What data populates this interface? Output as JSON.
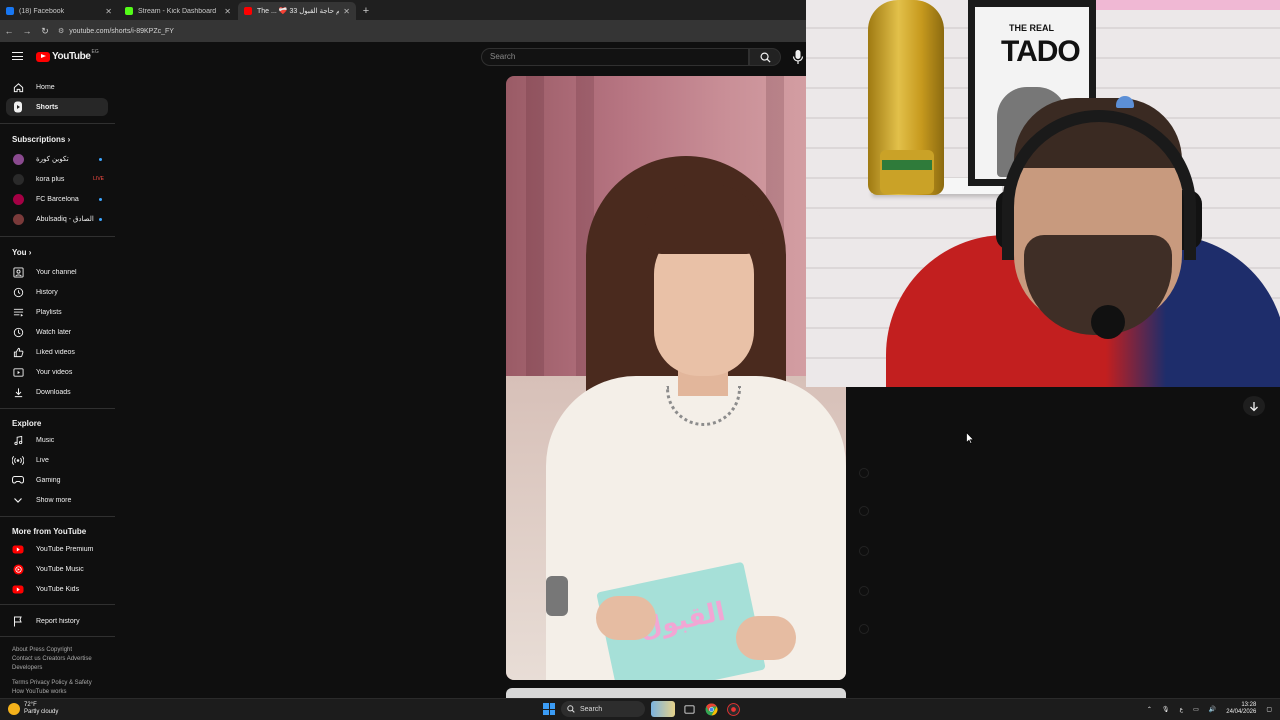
{
  "browser": {
    "tabs": [
      {
        "title": "(18) Facebook",
        "color": "#1877f2",
        "active": false
      },
      {
        "title": "Stream - Kick Dashboard",
        "color": "#53fc18",
        "active": false
      },
      {
        "title": "The ... ❤️‍🩹 33 اهم حاجة القبول",
        "color": "#ff0000",
        "active": true
      }
    ],
    "new_tab": "+",
    "url": "youtube.com/shorts/i-89KPZc_FY"
  },
  "masthead": {
    "logo_text": "YouTube",
    "country_code": "EG",
    "search_placeholder": "Search"
  },
  "sidebar": {
    "main": [
      {
        "label": "Home",
        "icon": "home-icon"
      },
      {
        "label": "Shorts",
        "icon": "shorts-icon",
        "active": true
      }
    ],
    "subscriptions_title": "Subscriptions",
    "subscriptions": [
      {
        "label": "تكوين كورة",
        "badge": "dot",
        "avatar_color": "#8a4a8f"
      },
      {
        "label": "kora plus",
        "badge": "live",
        "avatar_color": "#2a2a2a"
      },
      {
        "label": "FC Barcelona",
        "badge": "dot",
        "avatar_color": "#a50044"
      },
      {
        "label": "Abulsadiq - الصادق",
        "badge": "dot",
        "avatar_color": "#7a3a3a"
      }
    ],
    "live_badge": "LIVE",
    "you_title": "You",
    "you": [
      {
        "label": "Your channel",
        "icon": "channel-icon"
      },
      {
        "label": "History",
        "icon": "history-icon"
      },
      {
        "label": "Playlists",
        "icon": "playlists-icon"
      },
      {
        "label": "Watch later",
        "icon": "watch-later-icon"
      },
      {
        "label": "Liked videos",
        "icon": "like-icon"
      },
      {
        "label": "Your videos",
        "icon": "videos-icon"
      },
      {
        "label": "Downloads",
        "icon": "download-icon"
      }
    ],
    "explore_title": "Explore",
    "explore": [
      {
        "label": "Music",
        "icon": "music-icon"
      },
      {
        "label": "Live",
        "icon": "live-icon"
      },
      {
        "label": "Gaming",
        "icon": "gaming-icon"
      },
      {
        "label": "Show more",
        "icon": "chevron-down-icon"
      }
    ],
    "more_title": "More from YouTube",
    "more": [
      {
        "label": "YouTube Premium",
        "icon": "youtube-premium-icon"
      },
      {
        "label": "YouTube Music",
        "icon": "youtube-music-icon"
      },
      {
        "label": "YouTube Kids",
        "icon": "youtube-kids-icon"
      }
    ],
    "report_history": "Report history",
    "footer_line1": "About  Press  Copyright",
    "footer_line2": "Contact us  Creators  Advertise",
    "footer_line3": "Developers",
    "footer_line4": "Terms  Privacy  Policy & Safety",
    "footer_line5": "How YouTube works"
  },
  "short": {
    "card_text": "القبول"
  },
  "webcam": {
    "poster_line1": "THE REAL",
    "poster_line2": "TADO"
  },
  "taskbar": {
    "weather_temp": "72°F",
    "weather_desc": "Partly cloudy",
    "search_label": "Search",
    "time": "13:28",
    "date": "24/04/2026",
    "lang": "ع"
  }
}
